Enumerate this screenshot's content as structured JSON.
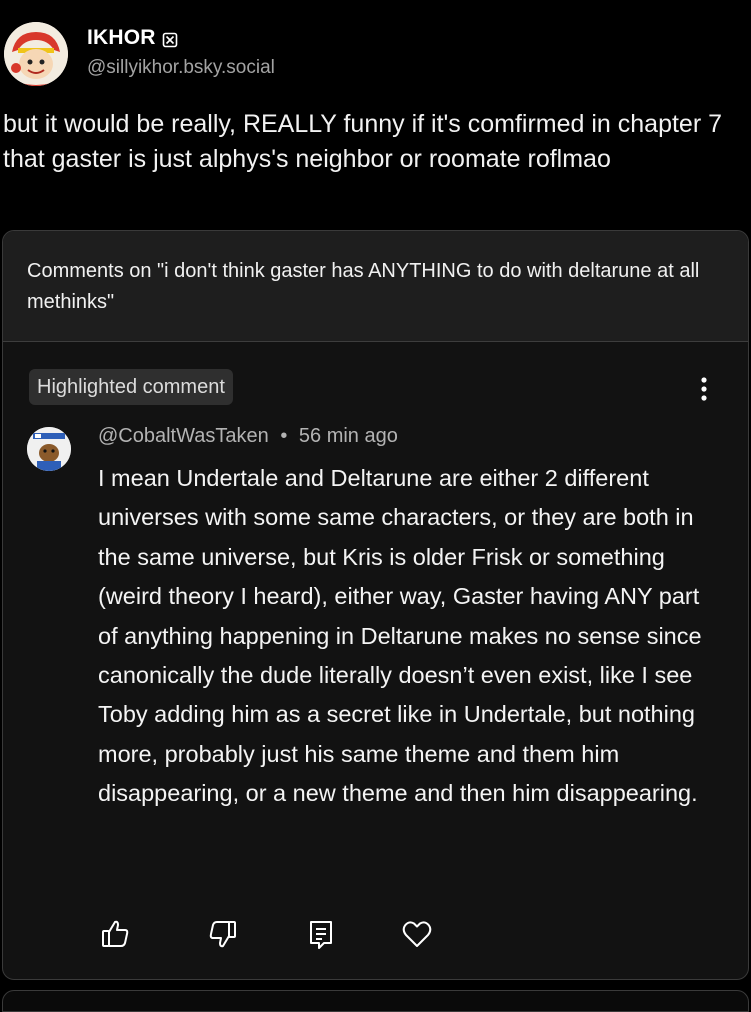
{
  "post": {
    "author_name": "IKHOR",
    "author_handle": "@sillyikhor.bsky.social",
    "text": "but it would be really, REALLY funny if it's comfirmed in chapter 7 that gaster is just alphys's neighbor or roomate roflmao"
  },
  "embedded": {
    "sheet_title": "Comments on \"i don't think gaster has ANYTHING to do with deltarune at all methinks\"",
    "chip_label": "Highlighted comment",
    "comment": {
      "author": "@CobaltWasTaken",
      "separator": "•",
      "time": "56 min ago",
      "text": "I mean Undertale and Deltarune are either 2 different universes with some same characters, or they are both in the same universe, but Kris is older Frisk or something (weird theory I heard), either way, Gaster having ANY part of anything happening in Deltarune makes no sense since canonically the dude literally doesn’t even exist, like I see Toby adding him as a secret like in Undertale, but nothing more, probably just his same theme and them him disappearing, or a new theme and then him disappearing."
    },
    "actions": [
      "like-icon",
      "dislike-icon",
      "reply-icon",
      "heart-icon"
    ]
  },
  "icons": {
    "badge": "circle-x-icon",
    "menu": "vertical-ellipsis-icon"
  },
  "colors": {
    "background": "#000000",
    "card": "#121212",
    "header": "#1e1e1e",
    "handle_gray": "#a3a3a3"
  }
}
